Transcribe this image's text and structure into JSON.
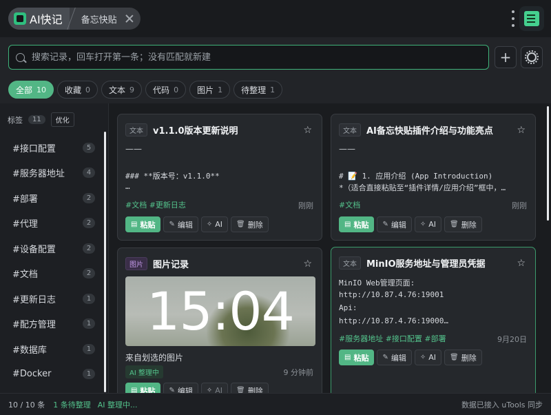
{
  "header": {
    "app_name": "AI快记",
    "current_tab": "备忘快贴"
  },
  "search": {
    "placeholder": "搜索记录，回车打开第一条；没有匹配就新建",
    "value": "",
    "add_label": "+"
  },
  "filters": [
    {
      "label": "全部",
      "count": "10",
      "active": true
    },
    {
      "label": "收藏",
      "count": "0"
    },
    {
      "label": "文本",
      "count": "9"
    },
    {
      "label": "代码",
      "count": "0"
    },
    {
      "label": "图片",
      "count": "1"
    },
    {
      "label": "待整理",
      "count": "1"
    }
  ],
  "sidebar": {
    "title": "标签",
    "count": "11",
    "optimize_label": "优化",
    "tags": [
      {
        "name": "#接口配置",
        "count": "5"
      },
      {
        "name": "#服务器地址",
        "count": "4"
      },
      {
        "name": "#部署",
        "count": "2"
      },
      {
        "name": "#代理",
        "count": "2"
      },
      {
        "name": "#设备配置",
        "count": "2"
      },
      {
        "name": "#文档",
        "count": "2"
      },
      {
        "name": "#更新日志",
        "count": "1"
      },
      {
        "name": "#配方管理",
        "count": "1"
      },
      {
        "name": "#数据库",
        "count": "1"
      },
      {
        "name": "#Docker",
        "count": "1"
      }
    ]
  },
  "actions": {
    "paste": "粘贴",
    "edit": "编辑",
    "ai": "AI",
    "delete": "删除"
  },
  "cards": [
    {
      "type": "文本",
      "title": "v1.1.0版本更新说明",
      "dash": "——",
      "lines": [
        "### **版本号：v1.1.0**",
        "…"
      ],
      "tags": "#文档 #更新日志",
      "time": "刚刚"
    },
    {
      "type": "文本",
      "title": "AI备忘快贴插件介绍与功能亮点",
      "dash": "——",
      "lines": [
        "# 📝 1. 应用介绍 (App Introduction)",
        "*（适合直接粘贴至“插件详情/应用介绍”框中，…"
      ],
      "tags": "#文档",
      "time": "刚刚"
    },
    {
      "type": "图片",
      "title": "图片记录",
      "image_text": "15:04",
      "caption": "来自划选的图片",
      "status": "AI 整理中",
      "time": "9 分钟前"
    },
    {
      "type": "文本",
      "title": "MinIO服务地址与管理员凭据",
      "lines": [
        "MinIO Web管理页面:",
        "http://10.87.4.76:19001",
        "Api:",
        "http://10.87.4.76:19000…"
      ],
      "tags": "#服务器地址 #接口配置 #部署",
      "time": "9月20日"
    }
  ],
  "status": {
    "count": "10 / 10 条",
    "pending": "1 条待整理",
    "ai": "AI 整理中...",
    "sync": "数据已接入 uTools 同步"
  }
}
